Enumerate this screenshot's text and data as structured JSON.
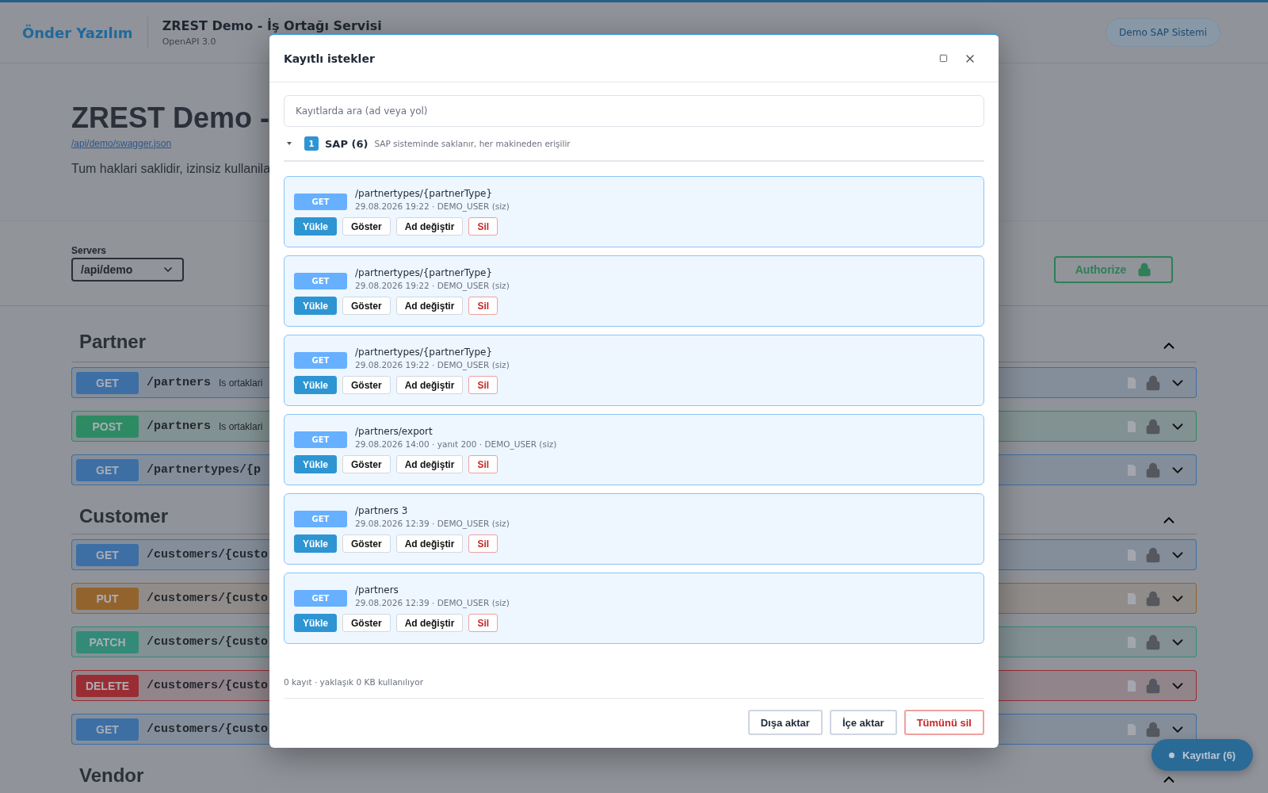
{
  "header": {
    "brand": "Önder Yazılım",
    "title": "ZREST Demo - İş Ortağı Servisi",
    "subtitle": "OpenAPI 3.0",
    "system_badge": "Demo SAP Sistemi"
  },
  "info": {
    "title": "ZREST Demo -",
    "spec_link": "/api/demo/swagger.json",
    "description": "Tum haklari saklidir, izinsiz kullanila"
  },
  "servers": {
    "label": "Servers",
    "value": "/api/demo",
    "authorize": "Authorize"
  },
  "sections": [
    {
      "name": "Partner",
      "expanded": true,
      "operations": [
        {
          "method": "GET",
          "color": "#3d6fa5",
          "path": "/partners",
          "summary": "Is ortaklari"
        },
        {
          "method": "POST",
          "color": "#2e8a63",
          "path": "/partners",
          "summary": "Is ortaklari"
        },
        {
          "method": "GET",
          "color": "#3d6fa5",
          "path": "/partnertypes/{p"
        }
      ]
    },
    {
      "name": "Customer",
      "expanded": true,
      "operations": [
        {
          "method": "GET",
          "color": "#3d6fa5",
          "path": "/customers/{custo"
        },
        {
          "method": "PUT",
          "color": "#93632e",
          "path": "/customers/{custo"
        },
        {
          "method": "PATCH",
          "color": "#338a78",
          "path": "/customers/{custo"
        },
        {
          "method": "DELETE",
          "color": "#9a2d33",
          "path": "/customers/{custo"
        },
        {
          "method": "GET",
          "color": "#3d6fa5",
          "path": "/customers/{custo"
        }
      ]
    },
    {
      "name": "Vendor",
      "expanded": true
    }
  ],
  "dialog": {
    "title": "Kayıtlı istekler",
    "search": {
      "placeholder": "Kayıtlarda ara (ad veya yol)"
    },
    "group": {
      "count_badge": "1",
      "name": "SAP (6)",
      "note": "SAP sisteminde saklanır, her makineden erişilir",
      "expanded": true
    },
    "items": [
      {
        "method": "GET",
        "path": "/partnertypes/{partnerType}",
        "meta": "29.08.2026 19:22 · DEMO_USER (siz)",
        "actions": [
          {
            "label": "Yükle",
            "kind": "primary"
          },
          {
            "label": "Göster",
            "kind": "plain"
          },
          {
            "label": "Ad değiştir",
            "kind": "plain"
          },
          {
            "label": "Sil",
            "kind": "danger"
          }
        ]
      },
      {
        "method": "GET",
        "path": "/partnertypes/{partnerType}",
        "meta": "29.08.2026 19:22 · DEMO_USER (siz)",
        "actions": [
          {
            "label": "Yükle",
            "kind": "primary"
          },
          {
            "label": "Göster",
            "kind": "plain"
          },
          {
            "label": "Ad değiştir",
            "kind": "plain"
          },
          {
            "label": "Sil",
            "kind": "danger"
          }
        ]
      },
      {
        "method": "GET",
        "path": "/partnertypes/{partnerType}",
        "meta": "29.08.2026 19:22 · DEMO_USER (siz)",
        "actions": [
          {
            "label": "Yükle",
            "kind": "primary"
          },
          {
            "label": "Göster",
            "kind": "plain"
          },
          {
            "label": "Ad değiştir",
            "kind": "plain"
          },
          {
            "label": "Sil",
            "kind": "danger"
          }
        ]
      },
      {
        "method": "GET",
        "path": "/partners/export",
        "meta": "29.08.2026 14:00 · yanıt 200 · DEMO_USER (siz)",
        "actions": [
          {
            "label": "Yükle",
            "kind": "primary"
          },
          {
            "label": "Göster",
            "kind": "plain"
          },
          {
            "label": "Ad değiştir",
            "kind": "plain"
          },
          {
            "label": "Sil",
            "kind": "danger"
          }
        ]
      },
      {
        "method": "GET",
        "path": "/partners 3",
        "meta": "29.08.2026 12:39 · DEMO_USER (siz)",
        "actions": [
          {
            "label": "Yükle",
            "kind": "primary"
          },
          {
            "label": "Göster",
            "kind": "plain"
          },
          {
            "label": "Ad değiştir",
            "kind": "plain"
          },
          {
            "label": "Sil",
            "kind": "danger"
          }
        ]
      },
      {
        "method": "GET",
        "path": "/partners",
        "meta": "29.08.2026 12:39 · DEMO_USER (siz)",
        "actions": [
          {
            "label": "Yükle",
            "kind": "primary"
          },
          {
            "label": "Göster",
            "kind": "plain"
          },
          {
            "label": "Ad değiştir",
            "kind": "plain"
          },
          {
            "label": "Sil",
            "kind": "danger"
          }
        ]
      }
    ],
    "footer_note": "0 kayıt · yaklaşık 0 KB kullanılıyor",
    "buttons": [
      {
        "label": "Dışa aktar",
        "kind": "plain"
      },
      {
        "label": "İçe aktar",
        "kind": "plain"
      },
      {
        "label": "Tümünü sil",
        "kind": "danger"
      }
    ]
  },
  "records_button": "Kayıtlar (6)"
}
